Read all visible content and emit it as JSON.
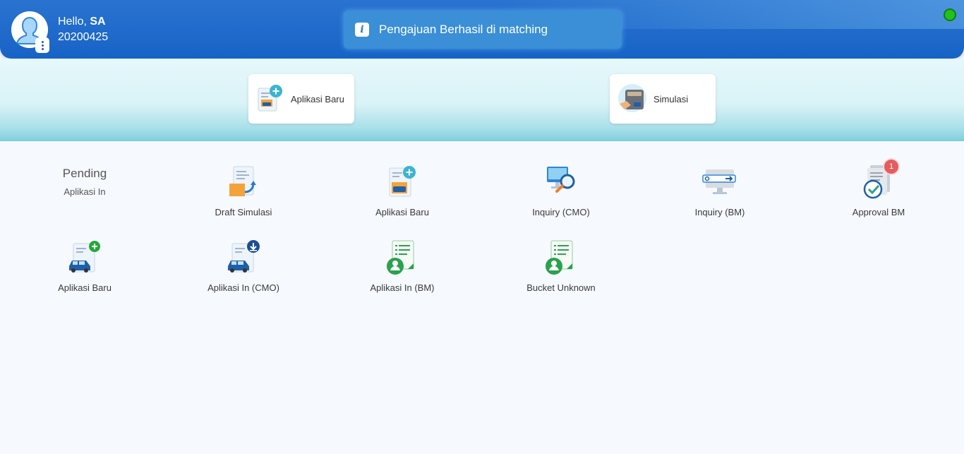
{
  "header": {
    "greeting_prefix": "Hello, ",
    "user_name": "SA",
    "user_id": "20200425",
    "status_color": "#22c21b"
  },
  "toast": {
    "icon": "info-icon",
    "message": "Pengajuan Berhasil di matching"
  },
  "banner": {
    "new_application": "Aplikasi Baru",
    "simulation": "Simulasi"
  },
  "pending": {
    "title": "Pending",
    "subtitle": "Aplikasi In"
  },
  "menu": {
    "draft_simulasi": "Draft Simulasi",
    "aplikasi_baru": "Aplikasi Baru",
    "inquiry_cmo": "Inquiry (CMO)",
    "inquiry_bm": "Inquiry (BM)",
    "approval_bm": "Approval BM",
    "approval_bm_badge": "1",
    "aplikasi_baru_2": "Aplikasi Baru",
    "aplikasi_in_cmo": "Aplikasi In (CMO)",
    "aplikasi_in_bm": "Aplikasi In (BM)",
    "bucket_unknown": "Bucket Unknown"
  }
}
